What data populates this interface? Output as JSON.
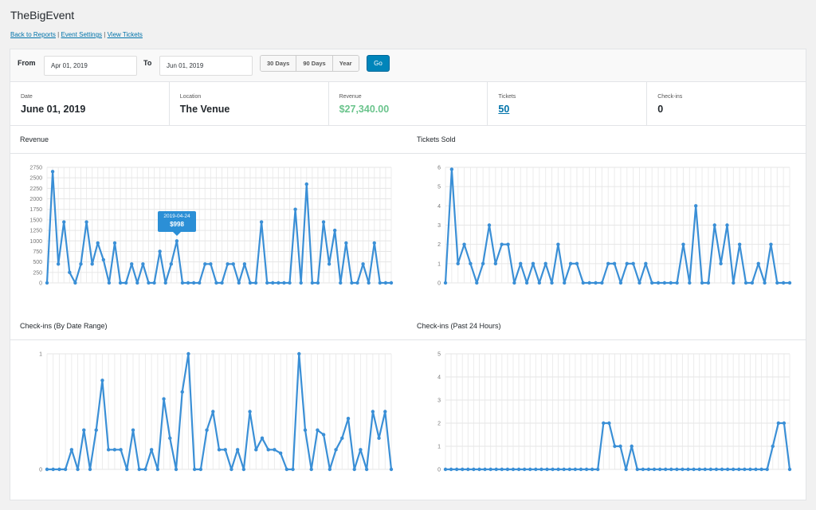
{
  "page": {
    "title": "TheBigEvent",
    "links": [
      "Back to Reports",
      "Event Settings",
      "View Tickets"
    ],
    "separator": "|"
  },
  "filter": {
    "from_label": "From",
    "to_label": "To",
    "from_value": "Apr 01, 2019",
    "to_value": "Jun 01, 2019",
    "ranges": [
      "30 Days",
      "90 Days",
      "Year"
    ],
    "go_label": "Go"
  },
  "stats": [
    {
      "label": "Date",
      "value": "June 01, 2019"
    },
    {
      "label": "Location",
      "value": "The Venue"
    },
    {
      "label": "Revenue",
      "value": "$27,340.00"
    },
    {
      "label": "Tickets",
      "value": "50"
    },
    {
      "label": "Check-ins",
      "value": "0"
    }
  ],
  "colors": {
    "line": "#3a8fd6",
    "revenue": "#6ac48c",
    "link": "#0073aa",
    "go": "#0085ba"
  },
  "tooltip": {
    "date": "2019-04-24",
    "value": "$998"
  },
  "chart_data": [
    {
      "type": "line",
      "title": "Revenue",
      "ylim": [
        0,
        2750
      ],
      "yticks": [
        0,
        250,
        500,
        750,
        1000,
        1250,
        1500,
        1750,
        2000,
        2250,
        2500,
        2750
      ],
      "values": [
        0,
        2650,
        450,
        1450,
        250,
        0,
        450,
        1450,
        450,
        950,
        550,
        0,
        950,
        0,
        0,
        450,
        0,
        450,
        0,
        0,
        750,
        0,
        450,
        998,
        0,
        0,
        0,
        0,
        450,
        450,
        0,
        0,
        450,
        450,
        0,
        450,
        0,
        0,
        1450,
        0,
        0,
        0,
        0,
        0,
        1750,
        0,
        2350,
        0,
        0,
        1450,
        450,
        1250,
        0,
        950,
        0,
        0,
        450,
        0,
        950,
        0,
        0,
        0
      ]
    },
    {
      "type": "line",
      "title": "Tickets Sold",
      "ylim": [
        0,
        6
      ],
      "yticks": [
        0,
        1,
        2,
        3,
        4,
        5,
        6
      ],
      "values": [
        0,
        5.9,
        1,
        2,
        1,
        0,
        1,
        3,
        1,
        2,
        2,
        0,
        1,
        0,
        1,
        0,
        1,
        0,
        2,
        0,
        1,
        1,
        0,
        0,
        0,
        0,
        1,
        1,
        0,
        1,
        1,
        0,
        1,
        0,
        0,
        0,
        0,
        0,
        2,
        0,
        4,
        0,
        0,
        3,
        1,
        3,
        0,
        2,
        0,
        0,
        1,
        0,
        2,
        0,
        0,
        0
      ]
    },
    {
      "type": "line",
      "title": "Check-ins (By Date Range)",
      "ylim": [
        0,
        1
      ],
      "yticks": [
        0,
        1
      ],
      "values": [
        0,
        0,
        0,
        0,
        0.17,
        0,
        0.34,
        0,
        0.34,
        0.77,
        0.17,
        0.17,
        0.17,
        0,
        0.34,
        0,
        0,
        0.17,
        0,
        0.61,
        0.27,
        0,
        0.67,
        1,
        0,
        0,
        0.34,
        0.5,
        0.17,
        0.17,
        0,
        0.17,
        0,
        0.5,
        0.17,
        0.27,
        0.17,
        0.17,
        0.14,
        0,
        0,
        1,
        0.34,
        0,
        0.34,
        0.3,
        0,
        0.17,
        0.27,
        0.44,
        0,
        0.17,
        0,
        0.5,
        0.27,
        0.5,
        0
      ]
    },
    {
      "type": "line",
      "title": "Check-ins (Past 24 Hours)",
      "ylim": [
        0,
        5
      ],
      "yticks": [
        0,
        1,
        2,
        3,
        4,
        5
      ],
      "values": [
        0,
        0,
        0,
        0,
        0,
        0,
        0,
        0,
        0,
        0,
        0,
        0,
        0,
        0,
        0,
        0,
        0,
        0,
        0,
        0,
        0,
        0,
        0,
        0,
        0,
        0,
        0,
        0,
        2,
        2,
        1,
        1,
        0,
        1,
        0,
        0,
        0,
        0,
        0,
        0,
        0,
        0,
        0,
        0,
        0,
        0,
        0,
        0,
        0,
        0,
        0,
        0,
        0,
        0,
        0,
        0,
        0,
        0,
        1,
        2,
        2,
        0
      ]
    }
  ]
}
